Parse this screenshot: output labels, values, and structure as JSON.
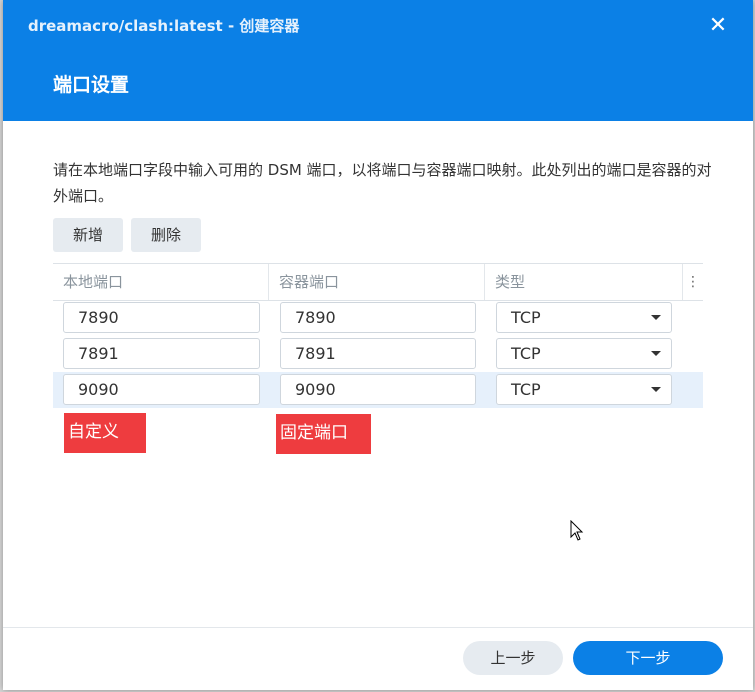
{
  "dialog": {
    "window_title": "dreamacro/clash:latest - 创建容器",
    "close_glyph": "✕",
    "section_title": "端口设置",
    "description": "请在本地端口字段中输入可用的 DSM 端口，以将端口与容器端口映射。此处列出的端口是容器的对外端口。"
  },
  "toolbar": {
    "add_label": "新增",
    "delete_label": "删除"
  },
  "table": {
    "headers": [
      "本地端口",
      "容器端口",
      "类型"
    ],
    "more_glyph": "⋮",
    "rows": [
      {
        "local": "7890",
        "container": "7890",
        "type": "TCP",
        "selected": false
      },
      {
        "local": "7891",
        "container": "7891",
        "type": "TCP",
        "selected": false
      },
      {
        "local": "9090",
        "container": "9090",
        "type": "TCP",
        "selected": true
      }
    ]
  },
  "annotations": {
    "custom_label": "自定义",
    "fixed_port_label": "固定端口"
  },
  "footer": {
    "prev_label": "上一步",
    "next_label": "下一步"
  },
  "colors": {
    "header_bg": "#0b80e6",
    "primary_button": "#0b80e6",
    "annotation_red": "#ee3c3f",
    "selected_row": "#e6f0fb"
  },
  "icons": {
    "close": "close-icon",
    "more": "more-vertical-icon",
    "dropdown": "chevron-down-icon",
    "cursor": "mouse-pointer-icon"
  }
}
